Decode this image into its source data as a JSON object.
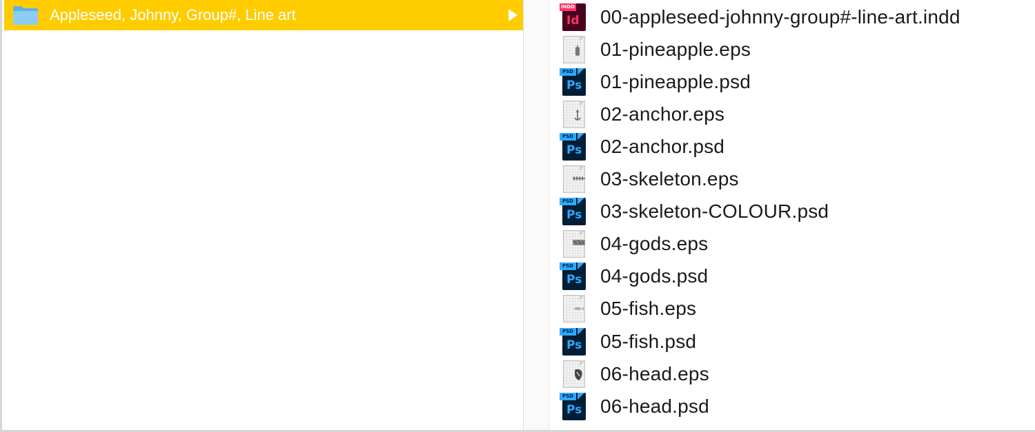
{
  "colors": {
    "selection": "#ffcc00",
    "indesign": "#ff3366",
    "photoshop": "#31a8ff"
  },
  "left_column": {
    "folder": {
      "icon": "folder-icon",
      "label": "Appleseed, Johnny, Group#, Line art"
    }
  },
  "files": [
    {
      "name": "00-appleseed-johnny-group#-line-art.indd",
      "type": "indd",
      "icon": "indesign-file-icon",
      "tag": "INDD",
      "glyph": "Id"
    },
    {
      "name": "01-pineapple.eps",
      "type": "eps",
      "icon": "eps-file-icon",
      "art": "pineapple"
    },
    {
      "name": "01-pineapple.psd",
      "type": "psd",
      "icon": "photoshop-file-icon",
      "tag": "PSD",
      "glyph": "Ps"
    },
    {
      "name": "02-anchor.eps",
      "type": "eps",
      "icon": "eps-file-icon",
      "art": "anchor"
    },
    {
      "name": "02-anchor.psd",
      "type": "psd",
      "icon": "photoshop-file-icon",
      "tag": "PSD",
      "glyph": "Ps"
    },
    {
      "name": "03-skeleton.eps",
      "type": "eps",
      "icon": "eps-file-icon",
      "art": "skeleton"
    },
    {
      "name": "03-skeleton-COLOUR.psd",
      "type": "psd",
      "icon": "photoshop-file-icon",
      "tag": "PSD",
      "glyph": "Ps"
    },
    {
      "name": "04-gods.eps",
      "type": "eps",
      "icon": "eps-file-icon",
      "art": "gods"
    },
    {
      "name": "04-gods.psd",
      "type": "psd",
      "icon": "photoshop-file-icon",
      "tag": "PSD",
      "glyph": "Ps"
    },
    {
      "name": "05-fish.eps",
      "type": "eps",
      "icon": "eps-file-icon",
      "art": "fish"
    },
    {
      "name": "05-fish.psd",
      "type": "psd",
      "icon": "photoshop-file-icon",
      "tag": "PSD",
      "glyph": "Ps"
    },
    {
      "name": "06-head.eps",
      "type": "eps",
      "icon": "eps-file-icon",
      "art": "head"
    },
    {
      "name": "06-head.psd",
      "type": "psd",
      "icon": "photoshop-file-icon",
      "tag": "PSD",
      "glyph": "Ps"
    }
  ]
}
